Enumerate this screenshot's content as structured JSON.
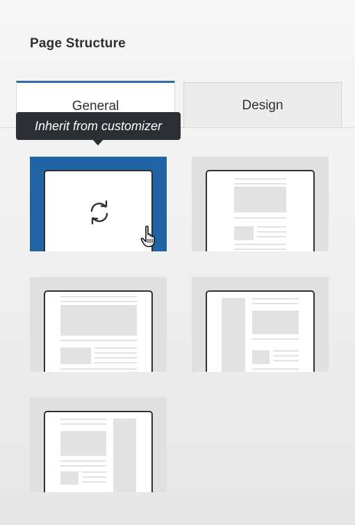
{
  "panel": {
    "title": "Page Structure"
  },
  "tabs": [
    {
      "label": "General",
      "active": true
    },
    {
      "label": "Design",
      "active": false
    }
  ],
  "tooltip": {
    "text": "Inherit from customizer"
  },
  "layout_options": [
    {
      "id": "inherit",
      "icon": "sync-icon",
      "selected": true
    },
    {
      "id": "no-sidebar-narrow",
      "icon": "layout-narrow-icon",
      "selected": false
    },
    {
      "id": "no-sidebar-wide",
      "icon": "layout-wide-icon",
      "selected": false
    },
    {
      "id": "left-sidebar",
      "icon": "layout-left-sidebar-icon",
      "selected": false
    },
    {
      "id": "right-sidebar",
      "icon": "layout-right-sidebar-icon",
      "selected": false
    }
  ],
  "colors": {
    "accent": "#2164a6",
    "tab_active_border": "#2c6aaa",
    "tooltip_bg": "#2b2f33"
  }
}
